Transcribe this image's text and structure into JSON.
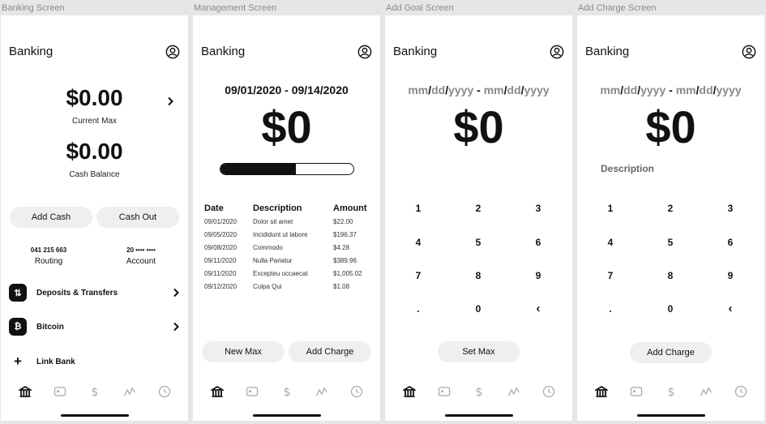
{
  "frames": {
    "banking": "Banking Screen",
    "management": "Management Screen",
    "add_goal": "Add Goal Screen",
    "add_charge": "Add Charge Screen"
  },
  "app_title": "Banking",
  "banking": {
    "current_max_value": "$0.00",
    "current_max_label": "Current Max",
    "cash_balance_value": "$0.00",
    "cash_balance_label": "Cash Balance",
    "add_cash": "Add Cash",
    "cash_out": "Cash Out",
    "routing_number": "041 215 663",
    "routing_label": "Routing",
    "account_number": "20 •••• ••••",
    "account_label": "Account",
    "deposits_transfers": "Deposits & Transfers",
    "bitcoin": "Bitcoin",
    "link_bank": "Link Bank"
  },
  "management": {
    "date_range": "09/01/2020 - 09/14/2020",
    "amount": "$0",
    "progress_fraction": 0.57,
    "columns": [
      "Date",
      "Description",
      "Amount"
    ],
    "rows": [
      [
        "09/01/2020",
        "Dolor sit amet",
        "$22.00"
      ],
      [
        "09/05/2020",
        "Incididunt ut labore",
        "$196.37"
      ],
      [
        "09/08/2020",
        "Commodo",
        "$4.28"
      ],
      [
        "09/11/2020",
        "Nulla Pariatur",
        "$389.96"
      ],
      [
        "09/11/2020",
        "Excepteu occaecat",
        "$1,005.02"
      ],
      [
        "09/12/2020",
        "Culpa Qui",
        "$1.08"
      ]
    ],
    "new_max": "New Max",
    "add_charge": "Add Charge"
  },
  "date_placeholder": {
    "mm": "mm",
    "dd": "dd",
    "yyyy": "yyyy",
    "slash": "/",
    "dash": " - "
  },
  "add_goal": {
    "amount": "$0",
    "set_max": "Set Max"
  },
  "add_charge": {
    "amount": "$0",
    "description_placeholder": "Description",
    "add_charge": "Add Charge"
  },
  "keypad": [
    "1",
    "2",
    "3",
    "4",
    "5",
    "6",
    "7",
    "8",
    "9",
    ".",
    "0",
    "‹"
  ],
  "tabs": [
    "home-icon",
    "card-icon",
    "dollar-icon",
    "activity-icon",
    "clock-icon"
  ]
}
